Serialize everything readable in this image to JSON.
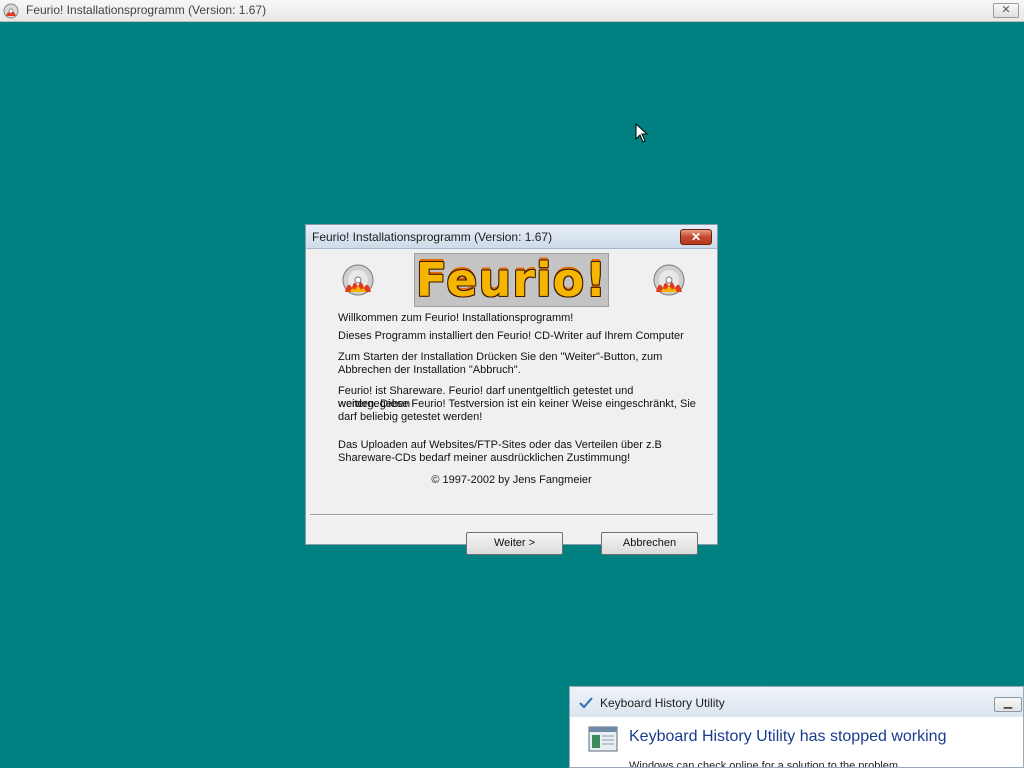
{
  "top_window": {
    "title": "Feurio! Installationsprogramm (Version: 1.67)",
    "close_glyph": "✕"
  },
  "dialog": {
    "title": "Feurio! Installationsprogramm (Version: 1.67)",
    "close_glyph": "✕",
    "logo_text": "Feurio!",
    "lines": [
      "Willkommen zum Feurio! Installationsprogramm!",
      "Dieses Programm installiert den Feurio! CD-Writer auf Ihrem Computer",
      "Zum Starten der Installation Drücken Sie den \"Weiter\"-Button, zum",
      "Abbrechen der Installation \"Abbruch\".",
      "Feurio! ist Shareware. Feurio! darf unentgeltlich getestet und weitergegeben",
      "werden. Diese Feurio! Testversion ist ein keiner Weise eingeschränkt, Sie",
      "darf beliebig getestet werden!",
      "Das Uploaden auf Websites/FTP-Sites oder das Verteilen über z.B",
      "Shareware-CDs bedarf meiner ausdrücklichen Zustimmung!"
    ],
    "copyright": "© 1997-2002  by Jens Fangmeier",
    "next_button": "Weiter >",
    "cancel_button": "Abbrechen"
  },
  "error_dialog": {
    "title": "Keyboard History Utility",
    "heading": "Keyboard History Utility has stopped working",
    "subtext": "Windows can check online for a solution to the problem."
  },
  "colors": {
    "desktop": "#008080",
    "close_red": "#c44a2f",
    "heading_blue": "#1a3c8f",
    "logo_fire": "#f6b500"
  },
  "icons": {
    "app": "feurio-cd-icon",
    "cursor": "arrow-cursor",
    "error_app": "window-icon"
  }
}
